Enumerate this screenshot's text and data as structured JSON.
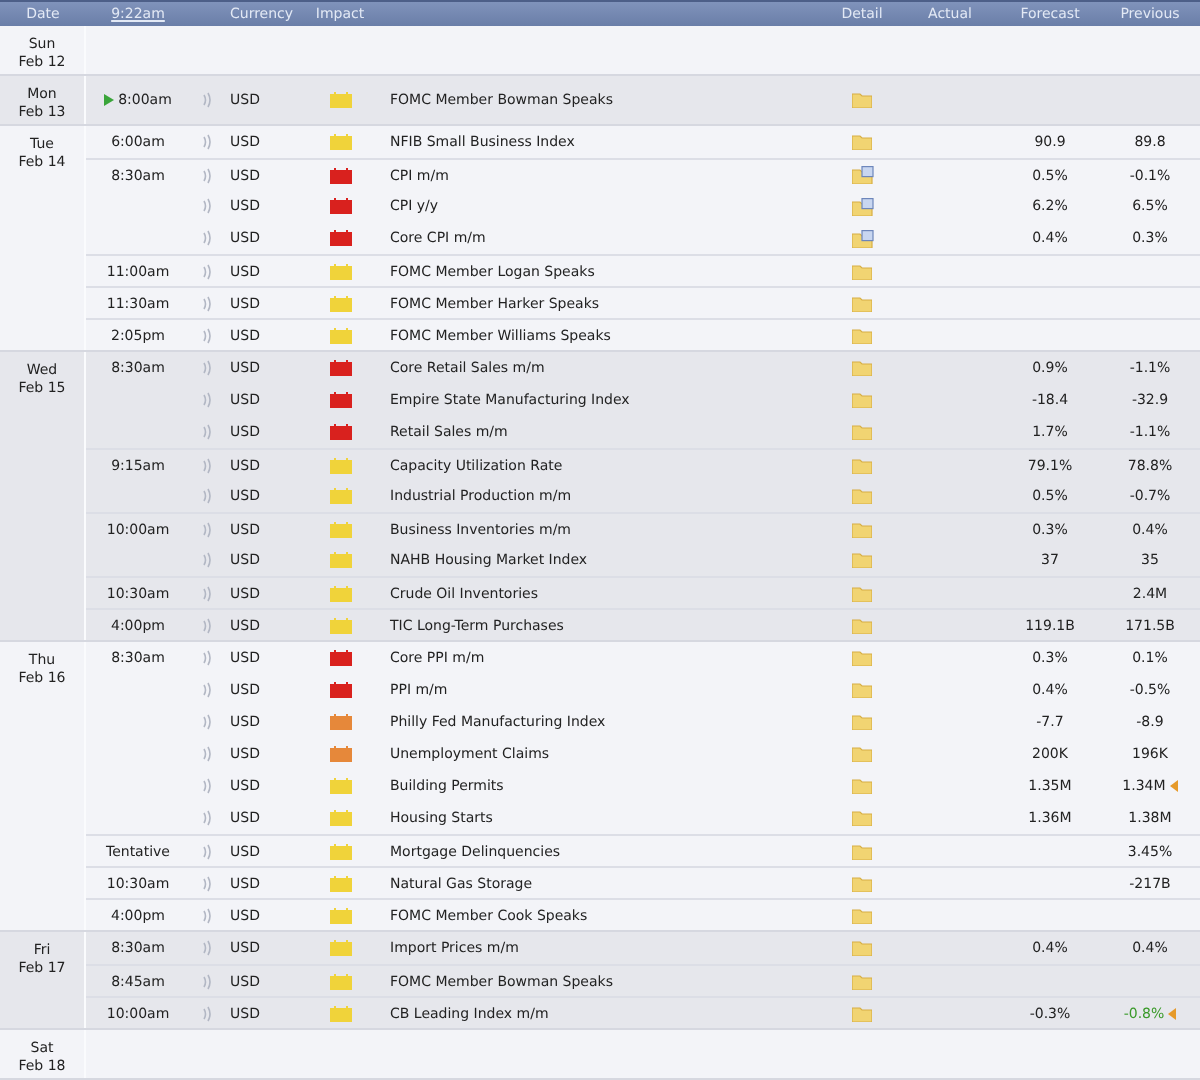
{
  "header": {
    "date": "Date",
    "time": "9:22am",
    "currency": "Currency",
    "impact": "Impact",
    "detail": "Detail",
    "actual": "Actual",
    "forecast": "Forecast",
    "previous": "Previous"
  },
  "days": [
    {
      "weekday": "Sun",
      "date": "Feb 12"
    },
    {
      "weekday": "Mon",
      "date": "Feb 13",
      "events": [
        {
          "time": "8:00am",
          "upcoming": true,
          "currency": "USD",
          "impact": {
            "color": "#f0d33a"
          },
          "title": "FOMC Member Bowman Speaks",
          "detail": {
            "kind": "folder"
          },
          "revised": false,
          "improved": false
        }
      ]
    },
    {
      "weekday": "Tue",
      "date": "Feb 14",
      "events": [
        {
          "time": "6:00am",
          "upcoming": false,
          "currency": "USD",
          "impact": {
            "color": "#f0d33a"
          },
          "title": "NFIB Small Business Index",
          "detail": {
            "kind": "folder"
          },
          "forecast": "90.9",
          "previous": "89.8",
          "revised": false,
          "improved": false
        },
        {
          "time": "8:30am",
          "upcoming": false,
          "currency": "USD",
          "impact": {
            "color": "#d9211e"
          },
          "title": "CPI m/m",
          "detail": {
            "kind": "document"
          },
          "forecast": "0.5%",
          "previous": "-0.1%",
          "revised": false,
          "improved": false
        },
        {
          "upcoming": false,
          "currency": "USD",
          "impact": {
            "color": "#d9211e"
          },
          "title": "CPI y/y",
          "detail": {
            "kind": "document"
          },
          "forecast": "6.2%",
          "previous": "6.5%",
          "revised": false,
          "improved": false
        },
        {
          "upcoming": false,
          "currency": "USD",
          "impact": {
            "color": "#d9211e"
          },
          "title": "Core CPI m/m",
          "detail": {
            "kind": "document"
          },
          "forecast": "0.4%",
          "previous": "0.3%",
          "revised": false,
          "improved": false
        },
        {
          "time": "11:00am",
          "upcoming": false,
          "currency": "USD",
          "impact": {
            "color": "#f0d33a"
          },
          "title": "FOMC Member Logan Speaks",
          "detail": {
            "kind": "folder"
          },
          "revised": false,
          "improved": false
        },
        {
          "time": "11:30am",
          "upcoming": false,
          "currency": "USD",
          "impact": {
            "color": "#f0d33a"
          },
          "title": "FOMC Member Harker Speaks",
          "detail": {
            "kind": "folder"
          },
          "revised": false,
          "improved": false
        },
        {
          "time": "2:05pm",
          "upcoming": false,
          "currency": "USD",
          "impact": {
            "color": "#f0d33a"
          },
          "title": "FOMC Member Williams Speaks",
          "detail": {
            "kind": "folder"
          },
          "revised": false,
          "improved": false
        }
      ]
    },
    {
      "weekday": "Wed",
      "date": "Feb 15",
      "events": [
        {
          "time": "8:30am",
          "upcoming": false,
          "currency": "USD",
          "impact": {
            "color": "#d9211e"
          },
          "title": "Core Retail Sales m/m",
          "detail": {
            "kind": "folder"
          },
          "forecast": "0.9%",
          "previous": "-1.1%",
          "revised": false,
          "improved": false
        },
        {
          "upcoming": false,
          "currency": "USD",
          "impact": {
            "color": "#d9211e"
          },
          "title": "Empire State Manufacturing Index",
          "detail": {
            "kind": "folder"
          },
          "forecast": "-18.4",
          "previous": "-32.9",
          "revised": false,
          "improved": false
        },
        {
          "upcoming": false,
          "currency": "USD",
          "impact": {
            "color": "#d9211e"
          },
          "title": "Retail Sales m/m",
          "detail": {
            "kind": "folder"
          },
          "forecast": "1.7%",
          "previous": "-1.1%",
          "revised": false,
          "improved": false
        },
        {
          "time": "9:15am",
          "upcoming": false,
          "currency": "USD",
          "impact": {
            "color": "#f0d33a"
          },
          "title": "Capacity Utilization Rate",
          "detail": {
            "kind": "folder"
          },
          "forecast": "79.1%",
          "previous": "78.8%",
          "revised": false,
          "improved": false
        },
        {
          "upcoming": false,
          "currency": "USD",
          "impact": {
            "color": "#f0d33a"
          },
          "title": "Industrial Production m/m",
          "detail": {
            "kind": "folder"
          },
          "forecast": "0.5%",
          "previous": "-0.7%",
          "revised": false,
          "improved": false
        },
        {
          "time": "10:00am",
          "upcoming": false,
          "currency": "USD",
          "impact": {
            "color": "#f0d33a"
          },
          "title": "Business Inventories m/m",
          "detail": {
            "kind": "folder"
          },
          "forecast": "0.3%",
          "previous": "0.4%",
          "revised": false,
          "improved": false
        },
        {
          "upcoming": false,
          "currency": "USD",
          "impact": {
            "color": "#f0d33a"
          },
          "title": "NAHB Housing Market Index",
          "detail": {
            "kind": "folder"
          },
          "forecast": "37",
          "previous": "35",
          "revised": false,
          "improved": false
        },
        {
          "time": "10:30am",
          "upcoming": false,
          "currency": "USD",
          "impact": {
            "color": "#f0d33a"
          },
          "title": "Crude Oil Inventories",
          "detail": {
            "kind": "folder"
          },
          "previous": "2.4M",
          "revised": false,
          "improved": false
        },
        {
          "time": "4:00pm",
          "upcoming": false,
          "currency": "USD",
          "impact": {
            "color": "#f0d33a"
          },
          "title": "TIC Long-Term Purchases",
          "detail": {
            "kind": "folder"
          },
          "forecast": "119.1B",
          "previous": "171.5B",
          "revised": false,
          "improved": false
        }
      ]
    },
    {
      "weekday": "Thu",
      "date": "Feb 16",
      "events": [
        {
          "time": "8:30am",
          "upcoming": false,
          "currency": "USD",
          "impact": {
            "color": "#d9211e"
          },
          "title": "Core PPI m/m",
          "detail": {
            "kind": "folder"
          },
          "forecast": "0.3%",
          "previous": "0.1%",
          "revised": false,
          "improved": false
        },
        {
          "upcoming": false,
          "currency": "USD",
          "impact": {
            "color": "#d9211e"
          },
          "title": "PPI m/m",
          "detail": {
            "kind": "folder"
          },
          "forecast": "0.4%",
          "previous": "-0.5%",
          "revised": false,
          "improved": false
        },
        {
          "upcoming": false,
          "currency": "USD",
          "impact": {
            "color": "#e6883a"
          },
          "title": "Philly Fed Manufacturing Index",
          "detail": {
            "kind": "folder"
          },
          "forecast": "-7.7",
          "previous": "-8.9",
          "revised": false,
          "improved": false
        },
        {
          "upcoming": false,
          "currency": "USD",
          "impact": {
            "color": "#e6883a"
          },
          "title": "Unemployment Claims",
          "detail": {
            "kind": "folder"
          },
          "forecast": "200K",
          "previous": "196K",
          "revised": false,
          "improved": false
        },
        {
          "upcoming": false,
          "currency": "USD",
          "impact": {
            "color": "#f0d33a"
          },
          "title": "Building Permits",
          "detail": {
            "kind": "folder"
          },
          "forecast": "1.35M",
          "previous": "1.34M",
          "revised": true,
          "improved": false
        },
        {
          "upcoming": false,
          "currency": "USD",
          "impact": {
            "color": "#f0d33a"
          },
          "title": "Housing Starts",
          "detail": {
            "kind": "folder"
          },
          "forecast": "1.36M",
          "previous": "1.38M",
          "revised": false,
          "improved": false
        },
        {
          "time": "Tentative",
          "upcoming": false,
          "currency": "USD",
          "impact": {
            "color": "#f0d33a"
          },
          "title": "Mortgage Delinquencies",
          "detail": {
            "kind": "folder"
          },
          "previous": "3.45%",
          "revised": false,
          "improved": false
        },
        {
          "time": "10:30am",
          "upcoming": false,
          "currency": "USD",
          "impact": {
            "color": "#f0d33a"
          },
          "title": "Natural Gas Storage",
          "detail": {
            "kind": "folder"
          },
          "previous": "-217B",
          "revised": false,
          "improved": false
        },
        {
          "time": "4:00pm",
          "upcoming": false,
          "currency": "USD",
          "impact": {
            "color": "#f0d33a"
          },
          "title": "FOMC Member Cook Speaks",
          "detail": {
            "kind": "folder"
          },
          "revised": false,
          "improved": false
        }
      ]
    },
    {
      "weekday": "Fri",
      "date": "Feb 17",
      "events": [
        {
          "time": "8:30am",
          "upcoming": false,
          "currency": "USD",
          "impact": {
            "color": "#f0d33a"
          },
          "title": "Import Prices m/m",
          "detail": {
            "kind": "folder"
          },
          "forecast": "0.4%",
          "previous": "0.4%",
          "revised": false,
          "improved": false
        },
        {
          "time": "8:45am",
          "upcoming": false,
          "currency": "USD",
          "impact": {
            "color": "#f0d33a"
          },
          "title": "FOMC Member Bowman Speaks",
          "detail": {
            "kind": "folder"
          },
          "revised": false,
          "improved": false
        },
        {
          "time": "10:00am",
          "upcoming": false,
          "currency": "USD",
          "impact": {
            "color": "#f0d33a"
          },
          "title": "CB Leading Index m/m",
          "detail": {
            "kind": "folder"
          },
          "forecast": "-0.3%",
          "previous": "-0.8%",
          "revised": true,
          "improved": true
        }
      ]
    },
    {
      "weekday": "Sat",
      "date": "Feb 18"
    }
  ]
}
